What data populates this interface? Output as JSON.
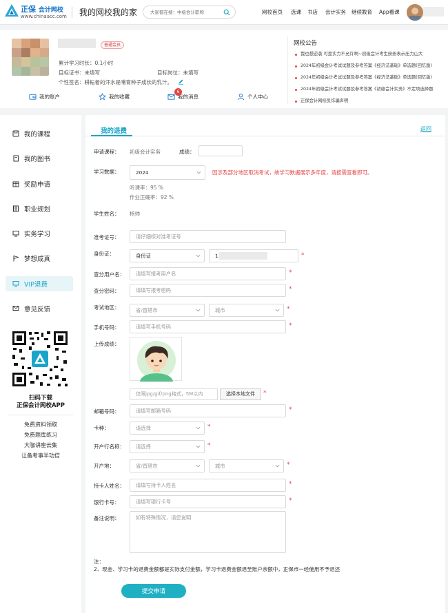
{
  "header": {
    "logo_name_a": "正保",
    "logo_name_b": "会计网校",
    "logo_url": "www.chinaacc.com",
    "site_title": "我的网校我的家",
    "search_placeholder": "大家都在搜：中级会计职称",
    "nav": [
      "网校首页",
      "选课",
      "书店",
      "会计实务",
      "继续教育",
      "App看课"
    ]
  },
  "profile": {
    "vip_badge": "普通会员",
    "study_time": "累计学习时长：0.1小时",
    "target_cert_label": "目标证书：",
    "target_cert_value": "未填写",
    "target_job_label": "目标岗位：",
    "target_job_value": "未填写",
    "signature_label": "个性签名：",
    "signature_value": "耕耘者的汗水是哺育种子成长的乳汁。",
    "tabs": {
      "account": "我的账户",
      "favorites": "我的收藏",
      "messages": "我的消息",
      "personal": "个人中心"
    },
    "message_count": "6"
  },
  "announcements": {
    "title": "网校公告",
    "items": [
      "我也想逆袭 可是实力不允许啊~初级会计考生纷纷表示压力山大",
      "2024年初级会计考试试题及参考答案《经济法基础》单选题(回忆版)",
      "2024年初级会计考试试题及参考答案《经济法基础》单选题(回忆版)",
      "2024年初级会计考试试题及参考答案《初级会计实务》不定项选择题",
      "正保会计网校反诈骗声明"
    ]
  },
  "sidebar": {
    "items": [
      "我的课程",
      "我的图书",
      "奖励申请",
      "职业规划",
      "实务学习",
      "梦想成真",
      "VIP退费",
      "意见反馈"
    ],
    "qr_line1": "扫码下载",
    "qr_line2": "正保会计网校APP",
    "promos": [
      "免费资料领取",
      "免费题库练习",
      "大咖讲座云集",
      "让备考事半功倍"
    ]
  },
  "main": {
    "tab_label": "我的退费",
    "back_label": "返回",
    "course_label": "申请课程：",
    "course_value": "初级会计实务",
    "score_label": "成绩：",
    "study_data_label": "学习数据：",
    "year_value": "2024",
    "year_note": "因涉及部分地区取消考试，故学习数据展示多年度，请按需查看即可。",
    "listen_rate": "听课率：95 %",
    "accuracy_rate": "作业正确率：92 %",
    "student_name_label": "学生姓名：",
    "student_name_value": "杨帅",
    "exam_no_label": "准考证号：",
    "exam_no_placeholder": "请仔细核对准考证号",
    "id_label": "身份证：",
    "id_type_value": "身份证",
    "id_prefix": "1",
    "query_user_label": "查分用户名：",
    "query_user_placeholder": "请填写报考用户名",
    "query_pwd_label": "查分密码：",
    "query_pwd_placeholder": "请填写报考密码",
    "exam_area_label": "考试地区：",
    "province_placeholder": "省/直辖市",
    "city_placeholder": "城市",
    "phone_label": "手机号码：",
    "phone_placeholder": "请填写手机号码",
    "upload_label": "上传成绩：",
    "file_hint": "仅限jpg/gif/png格式，5M以内",
    "file_button": "选择本地文件",
    "email_label": "邮箱号码：",
    "email_placeholder": "请填写邮箱号码",
    "card_type_label": "卡种：",
    "select_placeholder": "请选择",
    "bank_name_label": "开户行名称：",
    "bank_area_label": "开户地：",
    "holder_label": "持卡人姓名：",
    "holder_placeholder": "请填写持卡人姓名",
    "card_no_label": "银行卡号：",
    "card_no_placeholder": "请填写银行卡号",
    "remark_label": "备注说明：",
    "remark_placeholder": "如有特殊情况，请您说明",
    "note_label": "注：",
    "note_text": "2、现金、学习卡的退费金额都是实际支付金额，学习卡退费金额退至账户余额中，正保币一经使用不予退还",
    "submit_label": "提交申请"
  },
  "colors": {
    "accent": "#1aa5c8",
    "brand_blue": "#1a73c8",
    "required_red": "#e54545",
    "submit_bg": "#1fb0c4"
  }
}
